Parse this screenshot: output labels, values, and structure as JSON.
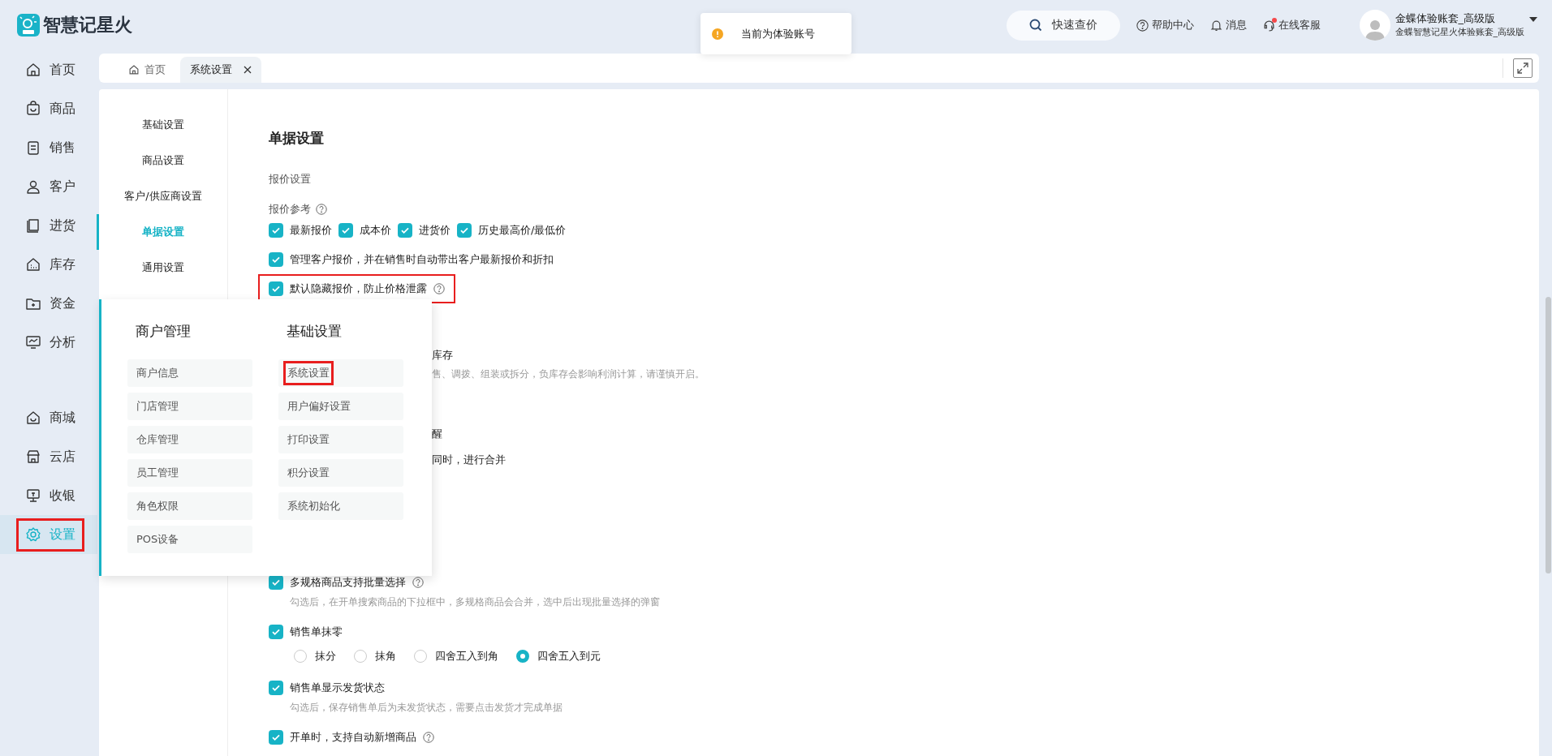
{
  "app": {
    "name": "智慧记星火"
  },
  "toast": {
    "text": "当前为体验账号"
  },
  "header": {
    "quick_search": "快速查价",
    "links": [
      {
        "label": "帮助中心",
        "badge": false
      },
      {
        "label": "消息",
        "badge": false
      },
      {
        "label": "在线客服",
        "badge": true
      }
    ],
    "user": {
      "name": "金蝶体验账套_高级版",
      "account": "金蝶智慧记星火体验账套_高级版"
    }
  },
  "sidebar": {
    "items": [
      {
        "label": "首页",
        "selected": false,
        "highlighted": false
      },
      {
        "label": "商品",
        "selected": false,
        "highlighted": false
      },
      {
        "label": "销售",
        "selected": false,
        "highlighted": false
      },
      {
        "label": "客户",
        "selected": false,
        "highlighted": false
      },
      {
        "label": "进货",
        "selected": false,
        "highlighted": false
      },
      {
        "label": "库存",
        "selected": false,
        "highlighted": false
      },
      {
        "label": "资金",
        "selected": false,
        "highlighted": false
      },
      {
        "label": "分析",
        "selected": false,
        "highlighted": false
      }
    ],
    "lower_items": [
      {
        "label": "商城",
        "selected": false,
        "highlighted": false
      },
      {
        "label": "云店",
        "selected": false,
        "highlighted": false
      },
      {
        "label": "收银",
        "selected": false,
        "highlighted": false
      },
      {
        "label": "设置",
        "selected": true,
        "highlighted": true
      }
    ]
  },
  "tabs": [
    {
      "label": "首页",
      "selected": false,
      "closable": false
    },
    {
      "label": "系统设置",
      "selected": true,
      "closable": true
    }
  ],
  "settings_nav": [
    {
      "label": "基础设置",
      "selected": false
    },
    {
      "label": "商品设置",
      "selected": false
    },
    {
      "label": "客户/供应商设置",
      "selected": false
    },
    {
      "label": "单据设置",
      "selected": true
    },
    {
      "label": "通用设置",
      "selected": false
    }
  ],
  "content": {
    "items": [
      {
        "kind": "heading",
        "text": "单据设置"
      },
      {
        "kind": "section",
        "text": "报价设置"
      },
      {
        "kind": "label",
        "text": "报价参考",
        "help": true
      },
      {
        "kind": "checkgroup",
        "options": [
          {
            "label": "最新报价",
            "checked": true
          },
          {
            "label": "成本价",
            "checked": true
          },
          {
            "label": "进货价",
            "checked": true
          },
          {
            "label": "历史最高价/最低价",
            "checked": true
          }
        ]
      },
      {
        "kind": "check",
        "label": "管理客户报价，并在销售时自动带出客户最新报价和折扣",
        "checked": true,
        "help": false,
        "highlighted": false
      },
      {
        "kind": "check",
        "label": "默认隐藏报价，防止价格泄露",
        "checked": true,
        "help": true,
        "highlighted": true
      },
      {
        "kind": "partial_label",
        "text": "库存"
      },
      {
        "kind": "partial_note",
        "text": "售、调拨、组装或拆分，负库存会影响利润计算，请谨慎开启。"
      },
      {
        "kind": "partial_label",
        "text": "醒"
      },
      {
        "kind": "partial_label",
        "text": "同时，进行合并"
      },
      {
        "kind": "check",
        "label": "多规格商品支持批量选择",
        "checked": true,
        "help": true,
        "highlighted": false,
        "description": "勾选后，在开单搜索商品的下拉框中，多规格商品会合并，选中后出现批量选择的弹窗"
      },
      {
        "kind": "check",
        "label": "销售单抹零",
        "checked": true,
        "help": false,
        "highlighted": false
      },
      {
        "kind": "radios",
        "options": [
          {
            "label": "抹分",
            "selected": false
          },
          {
            "label": "抹角",
            "selected": false
          },
          {
            "label": "四舍五入到角",
            "selected": false
          },
          {
            "label": "四舍五入到元",
            "selected": true
          }
        ]
      },
      {
        "kind": "check",
        "label": "销售单显示发货状态",
        "checked": true,
        "help": false,
        "highlighted": false,
        "description": "勾选后，保存销售单后为未发货状态，需要点击发货才完成单据"
      },
      {
        "kind": "check",
        "label": "开单时，支持自动新增商品",
        "checked": true,
        "help": true,
        "highlighted": false
      }
    ]
  },
  "popup": {
    "columns": [
      {
        "title": "商户管理",
        "items": [
          {
            "label": "商户信息",
            "highlighted": false
          },
          {
            "label": "门店管理",
            "highlighted": false
          },
          {
            "label": "仓库管理",
            "highlighted": false
          },
          {
            "label": "员工管理",
            "highlighted": false
          },
          {
            "label": "角色权限",
            "highlighted": false
          },
          {
            "label": "POS设备",
            "highlighted": false
          }
        ]
      },
      {
        "title": "基础设置",
        "items": [
          {
            "label": "系统设置",
            "highlighted": true
          },
          {
            "label": "用户偏好设置",
            "highlighted": false
          },
          {
            "label": "打印设置",
            "highlighted": false
          },
          {
            "label": "积分设置",
            "highlighted": false
          },
          {
            "label": "系统初始化",
            "highlighted": false
          }
        ]
      }
    ]
  }
}
